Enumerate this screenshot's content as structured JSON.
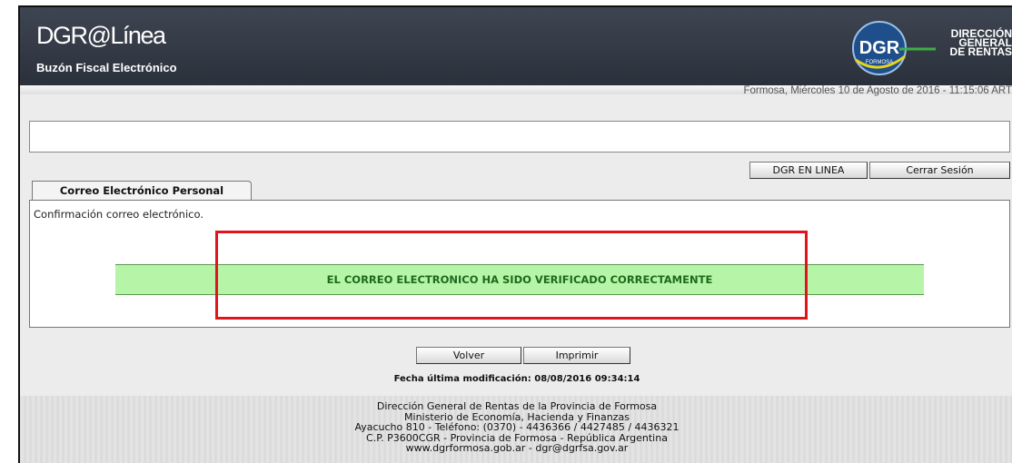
{
  "header": {
    "app_title": "DGR@Línea",
    "subtitle": "Buzón Fiscal Electrónico",
    "logo": {
      "abbr": "DGR",
      "sub": "FORMOSA",
      "lines": [
        "DIRECCIÓN",
        "GENERAL",
        "DE RENTAS"
      ]
    },
    "datetime": "Formosa, Miércoles 10 de Agosto de 2016 - 11:15:06 ART"
  },
  "top_buttons": {
    "dgr_en_linea": "DGR EN LINEA",
    "cerrar_sesion": "Cerrar Sesión"
  },
  "tab": {
    "label": "Correo Electrónico Personal"
  },
  "content": {
    "label": "Confirmación correo electrónico.",
    "success_message": "EL CORREO ELECTRONICO HA SIDO VERIFICADO CORRECTAMENTE"
  },
  "bottom_buttons": {
    "volver": "Volver",
    "imprimir": "Imprimir"
  },
  "last_modified": "Fecha última modificación: 08/08/2016 09:34:14",
  "footer": {
    "lines": [
      "Dirección General de Rentas de la Provincia de Formosa",
      "Ministerio de Economía, Hacienda y Finanzas",
      "Ayacucho 810 - Teléfono: (0370) - 4436366 / 4427485 / 4436321",
      "C.P. P3600CGR - Provincia de Formosa - República Argentina",
      "www.dgrformosa.gob.ar - dgr@dgrfsa.gov.ar"
    ]
  },
  "colors": {
    "header_bg": "#333a45",
    "success_bg": "#b6f5a8",
    "success_text": "#1d6a1d",
    "highlight": "#e2141b"
  }
}
